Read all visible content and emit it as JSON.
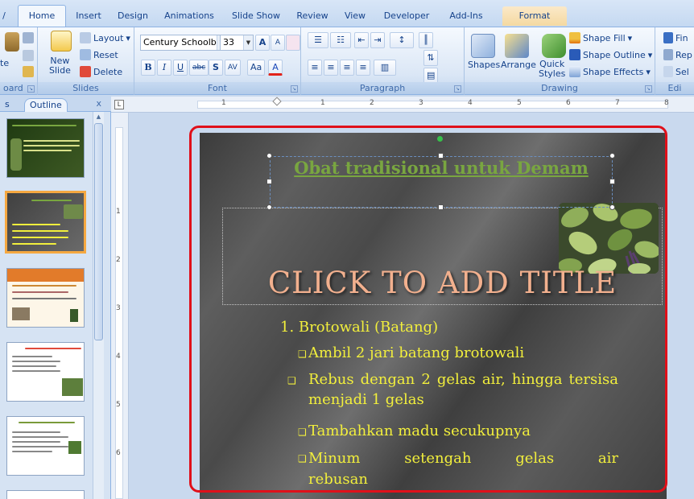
{
  "tabs": [
    "Home",
    "Insert",
    "Design",
    "Animations",
    "Slide Show",
    "Review",
    "View",
    "Developer",
    "Add-Ins",
    "Format"
  ],
  "ribbon": {
    "clipboard": {
      "label": "oard",
      "paste": "te"
    },
    "slides": {
      "new_slide": "New\nSlide",
      "layout": "Layout",
      "reset": "Reset",
      "delete": "Delete",
      "label": "Slides"
    },
    "font": {
      "name": "Century Schoolb",
      "size": "33",
      "bold": "B",
      "italic": "I",
      "underline": "U",
      "strike": "abc",
      "shadow": "S",
      "spacing": "AV",
      "case": "Aa",
      "color": "A",
      "grow": "A",
      "shrink": "A",
      "label": "Font"
    },
    "paragraph": {
      "label": "Paragraph"
    },
    "drawing": {
      "shapes": "Shapes",
      "arrange": "Arrange",
      "quick_styles": "Quick\nStyles",
      "shape_fill": "Shape Fill",
      "shape_outline": "Shape Outline",
      "shape_effects": "Shape Effects",
      "label": "Drawing"
    },
    "editing": {
      "find": "Fin",
      "replace": "Rep",
      "select": "Sel",
      "label": "Edi"
    }
  },
  "pane": {
    "tab_slides": "s",
    "tab_outline": "Outline",
    "close": "x"
  },
  "ruler": {
    "h_numbers": [
      "1",
      "1",
      "2",
      "3",
      "4",
      "5",
      "6",
      "7",
      "8"
    ],
    "v_numbers": [
      "1",
      "2",
      "3",
      "4",
      "5",
      "6"
    ]
  },
  "slide": {
    "title": "Obat tradisional untuk Demam",
    "placeholder_title": "CLICK TO ADD TITLE",
    "heading": "1. Brotowali (Batang)",
    "bullets": [
      "Ambil 2 jari batang brotowali",
      "Rebus dengan 2 gelas air, hingga tersisa menjadi 1 gelas",
      "Tambahkan madu secukupnya"
    ],
    "bullet4_words": [
      "Minum",
      "setengah",
      "gelas",
      "air"
    ],
    "bullet4_cont": "rebusan"
  },
  "colors": {
    "title_green": "#79a640",
    "body_yellow": "#f2ef3c",
    "placeholder_peach": "#f2b08e",
    "highlight_red": "#e0101a"
  }
}
